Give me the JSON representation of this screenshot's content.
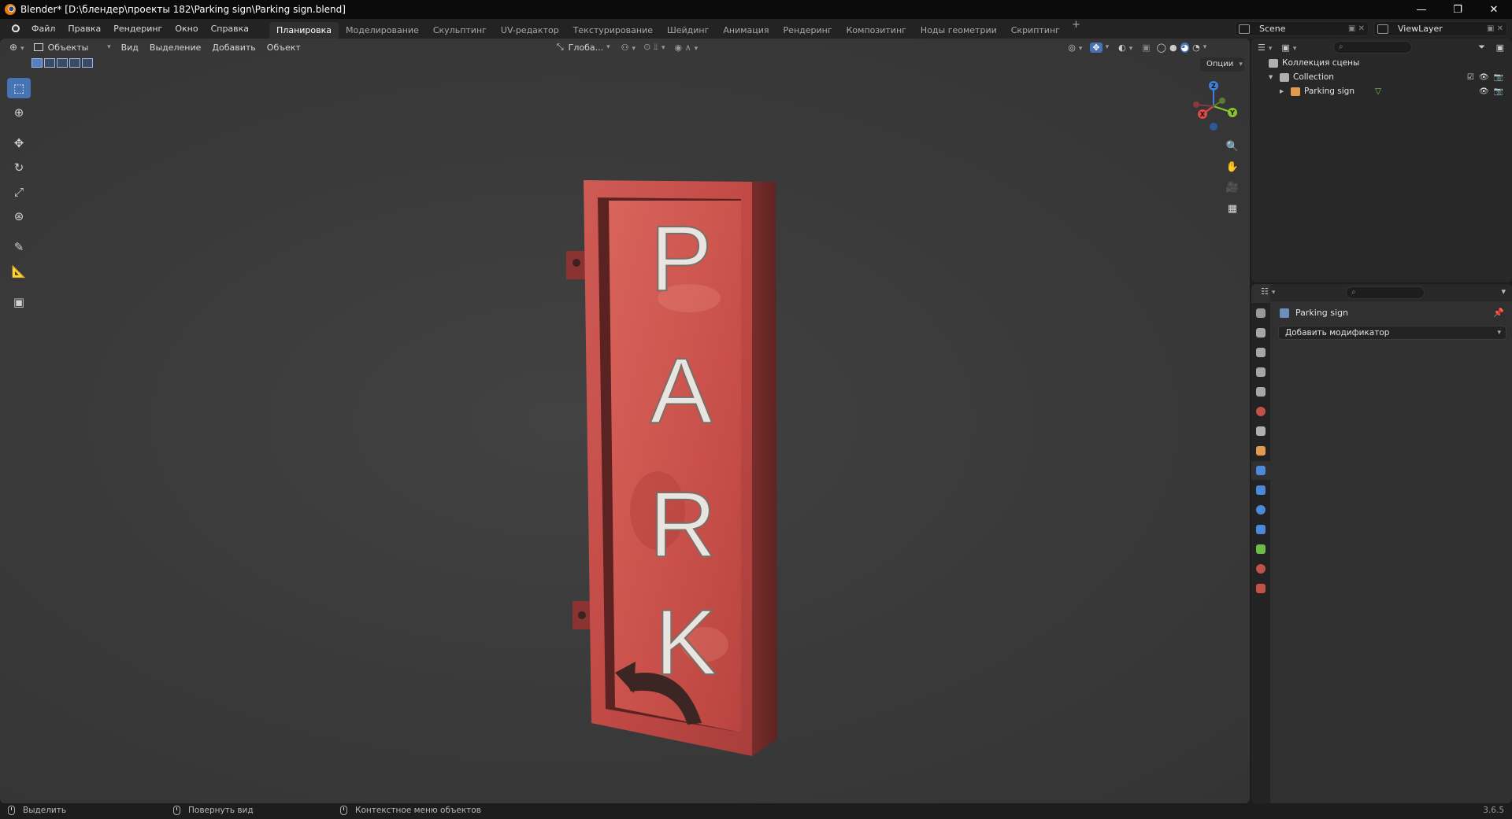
{
  "window": {
    "title": "Blender* [D:\\блендер\\проекты 182\\Parking sign\\Parking sign.blend]",
    "controls": [
      "—",
      "❐",
      "✕"
    ]
  },
  "menu": [
    "Файл",
    "Правка",
    "Рендеринг",
    "Окно",
    "Справка"
  ],
  "workspaces": {
    "active": "Планировка",
    "tabs": [
      "Планировка",
      "Моделирование",
      "Скульптинг",
      "UV-редактор",
      "Текстурирование",
      "Шейдинг",
      "Анимация",
      "Рендеринг",
      "Композитинг",
      "Ноды геометрии",
      "Скриптинг"
    ],
    "add": "+"
  },
  "scene": {
    "name": "Scene",
    "view_layer": "ViewLayer"
  },
  "viewport": {
    "mode": "Объекты",
    "menus": [
      "Вид",
      "Выделение",
      "Добавить",
      "Объект"
    ],
    "orientation": "Глоба...",
    "options_label": "Опции",
    "gizmo": {
      "x": "X",
      "y": "Y",
      "z": "Z"
    },
    "tools": [
      "select-box-icon",
      "cursor-icon",
      "move-icon",
      "rotate-icon",
      "scale-icon",
      "transform-icon",
      "annotate-icon",
      "measure-icon",
      "add-cube-icon"
    ],
    "sign_text": [
      "P",
      "A",
      "R",
      "K"
    ]
  },
  "outliner": {
    "root": "Коллекция сцены",
    "collection": "Collection",
    "object": "Parking sign"
  },
  "properties": {
    "object_name": "Parking sign",
    "add_modifier": "Добавить модификатор"
  },
  "statusbar": {
    "select": "Выделить",
    "rotate": "Повернуть вид",
    "context": "Контекстное меню объектов",
    "version": "3.6.5"
  },
  "colors": {
    "accent": "#4772b3",
    "sign_red": "#c24a46",
    "axis_x": "#e04848",
    "axis_y": "#8ac231",
    "axis_z": "#3d7fd9"
  }
}
